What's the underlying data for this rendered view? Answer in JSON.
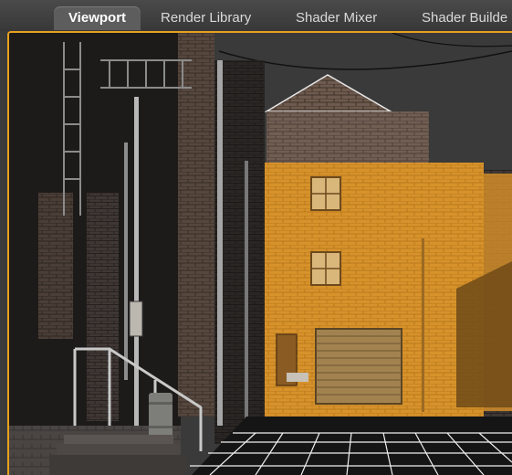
{
  "tabs": [
    {
      "label": "Viewport",
      "active": true
    },
    {
      "label": "Render Library",
      "active": false
    },
    {
      "label": "Shader Mixer",
      "active": false
    },
    {
      "label": "Shader Builde",
      "active": false
    }
  ],
  "colors": {
    "selection_highlight": "#e8a11d",
    "tab_active_bg": "#5d5d5d",
    "tab_bar_bg": "#3e3e3e"
  },
  "viewport": {
    "scene": "3D alley street scene with brick buildings; center building selected and highlighted in orange; white perspective floor grid"
  }
}
